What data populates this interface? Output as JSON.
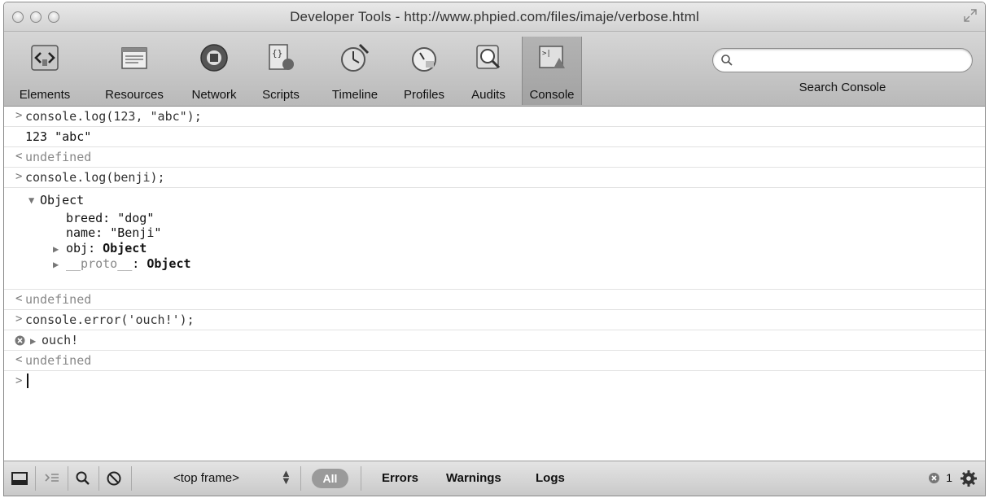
{
  "window": {
    "title": "Developer Tools - http://www.phpied.com/files/imaje/verbose.html"
  },
  "toolbar": {
    "tabs": [
      {
        "label": "Elements",
        "icon": "elements-icon"
      },
      {
        "label": "Resources",
        "icon": "resources-icon"
      },
      {
        "label": "Network",
        "icon": "network-icon"
      },
      {
        "label": "Scripts",
        "icon": "scripts-icon"
      },
      {
        "label": "Timeline",
        "icon": "timeline-icon"
      },
      {
        "label": "Profiles",
        "icon": "profiles-icon"
      },
      {
        "label": "Audits",
        "icon": "audits-icon"
      },
      {
        "label": "Console",
        "icon": "console-icon",
        "selected": true
      }
    ],
    "search": {
      "placeholder": "",
      "value": "",
      "label": "Search Console"
    }
  },
  "console": {
    "rows": [
      {
        "type": "input",
        "prompt": ">",
        "text": "console.log(123, \"abc\");"
      },
      {
        "type": "log",
        "text": "123 \"abc\""
      },
      {
        "type": "result",
        "prompt": "<",
        "text": "undefined"
      },
      {
        "type": "input",
        "prompt": ">",
        "text": "console.log(benji);"
      },
      {
        "type": "object",
        "header": "Object",
        "props": [
          {
            "key": "breed",
            "value": "\"dog\""
          },
          {
            "key": "name",
            "value": "\"Benji\""
          }
        ],
        "children": [
          {
            "key": "obj",
            "value": "Object"
          },
          {
            "key": "__proto__",
            "value": "Object"
          }
        ]
      },
      {
        "type": "result",
        "prompt": "<",
        "text": "undefined"
      },
      {
        "type": "input",
        "prompt": ">",
        "text": "console.error('ouch!');"
      },
      {
        "type": "error",
        "text": "ouch!"
      },
      {
        "type": "result",
        "prompt": "<",
        "text": "undefined"
      },
      {
        "type": "prompt",
        "prompt": ">",
        "text": ""
      }
    ]
  },
  "statusbar": {
    "frame": "<top frame>",
    "filters": {
      "all": "All",
      "errors": "Errors",
      "warnings": "Warnings",
      "logs": "Logs"
    },
    "error_count": "1"
  }
}
